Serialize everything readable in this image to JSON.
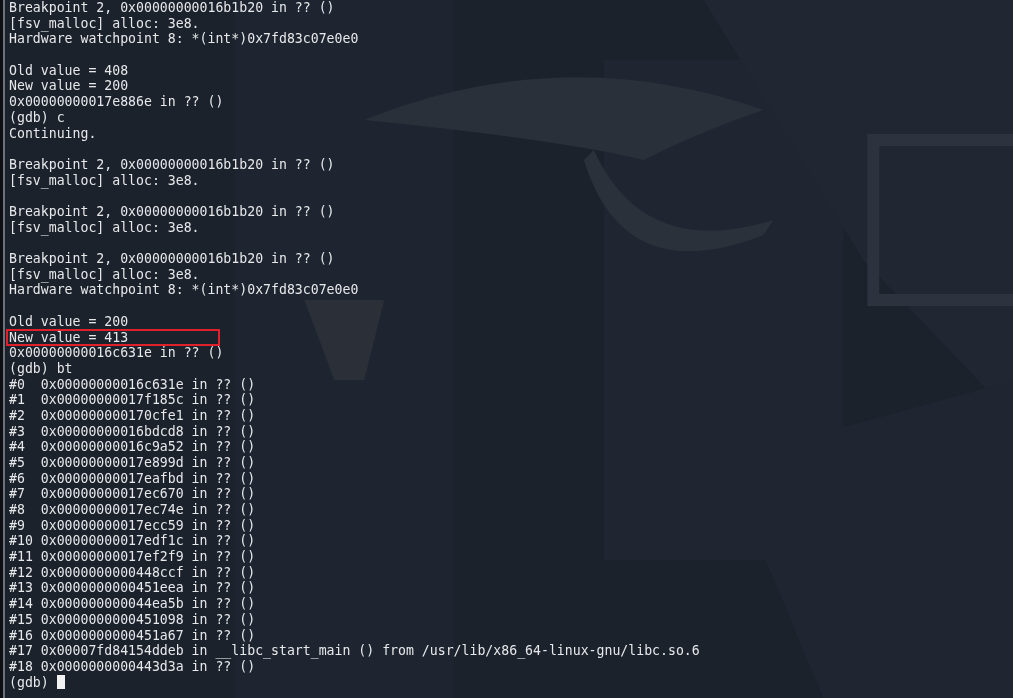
{
  "terminal": {
    "lines": [
      {
        "kind": "text",
        "text": "Breakpoint 2, 0x00000000016b1b20 in ?? ()"
      },
      {
        "kind": "text",
        "text": "[fsv_malloc] alloc: 3e8."
      },
      {
        "kind": "text",
        "text": "Hardware watchpoint 8: *(int*)0x7fd83c07e0e0"
      },
      {
        "kind": "blank"
      },
      {
        "kind": "text",
        "text": "Old value = 408"
      },
      {
        "kind": "text",
        "text": "New value = 200"
      },
      {
        "kind": "text",
        "text": "0x00000000017e886e in ?? ()"
      },
      {
        "kind": "text",
        "text": "(gdb) c"
      },
      {
        "kind": "text",
        "text": "Continuing."
      },
      {
        "kind": "blank"
      },
      {
        "kind": "text",
        "text": "Breakpoint 2, 0x00000000016b1b20 in ?? ()"
      },
      {
        "kind": "text",
        "text": "[fsv_malloc] alloc: 3e8."
      },
      {
        "kind": "blank"
      },
      {
        "kind": "text",
        "text": "Breakpoint 2, 0x00000000016b1b20 in ?? ()"
      },
      {
        "kind": "text",
        "text": "[fsv_malloc] alloc: 3e8."
      },
      {
        "kind": "blank"
      },
      {
        "kind": "text",
        "text": "Breakpoint 2, 0x00000000016b1b20 in ?? ()"
      },
      {
        "kind": "text",
        "text": "[fsv_malloc] alloc: 3e8."
      },
      {
        "kind": "text",
        "text": "Hardware watchpoint 8: *(int*)0x7fd83c07e0e0"
      },
      {
        "kind": "blank"
      },
      {
        "kind": "text",
        "text": "Old value = 200"
      },
      {
        "kind": "text",
        "text": "New value = 413",
        "highlighted": true
      },
      {
        "kind": "text",
        "text": "0x00000000016c631e in ?? ()"
      },
      {
        "kind": "text",
        "text": "(gdb) bt"
      },
      {
        "kind": "text",
        "text": "#0  0x00000000016c631e in ?? ()"
      },
      {
        "kind": "text",
        "text": "#1  0x00000000017f185c in ?? ()"
      },
      {
        "kind": "text",
        "text": "#2  0x000000000170cfe1 in ?? ()"
      },
      {
        "kind": "text",
        "text": "#3  0x00000000016bdcd8 in ?? ()"
      },
      {
        "kind": "text",
        "text": "#4  0x00000000016c9a52 in ?? ()"
      },
      {
        "kind": "text",
        "text": "#5  0x00000000017e899d in ?? ()"
      },
      {
        "kind": "text",
        "text": "#6  0x00000000017eafbd in ?? ()"
      },
      {
        "kind": "text",
        "text": "#7  0x00000000017ec670 in ?? ()"
      },
      {
        "kind": "text",
        "text": "#8  0x00000000017ec74e in ?? ()"
      },
      {
        "kind": "text",
        "text": "#9  0x00000000017ecc59 in ?? ()"
      },
      {
        "kind": "text",
        "text": "#10 0x00000000017edf1c in ?? ()"
      },
      {
        "kind": "text",
        "text": "#11 0x00000000017ef2f9 in ?? ()"
      },
      {
        "kind": "text",
        "text": "#12 0x0000000000448ccf in ?? ()"
      },
      {
        "kind": "text",
        "text": "#13 0x0000000000451eea in ?? ()"
      },
      {
        "kind": "text",
        "text": "#14 0x000000000044ea5b in ?? ()"
      },
      {
        "kind": "text",
        "text": "#15 0x0000000000451098 in ?? ()"
      },
      {
        "kind": "text",
        "text": "#16 0x0000000000451a67 in ?? ()"
      },
      {
        "kind": "text",
        "text": "#17 0x00007fd84154ddeb in __libc_start_main () from /usr/lib/x86_64-linux-gnu/libc.so.6"
      },
      {
        "kind": "text",
        "text": "#18 0x0000000000443d3a in ?? ()"
      },
      {
        "kind": "prompt",
        "text": "(gdb)"
      }
    ]
  }
}
